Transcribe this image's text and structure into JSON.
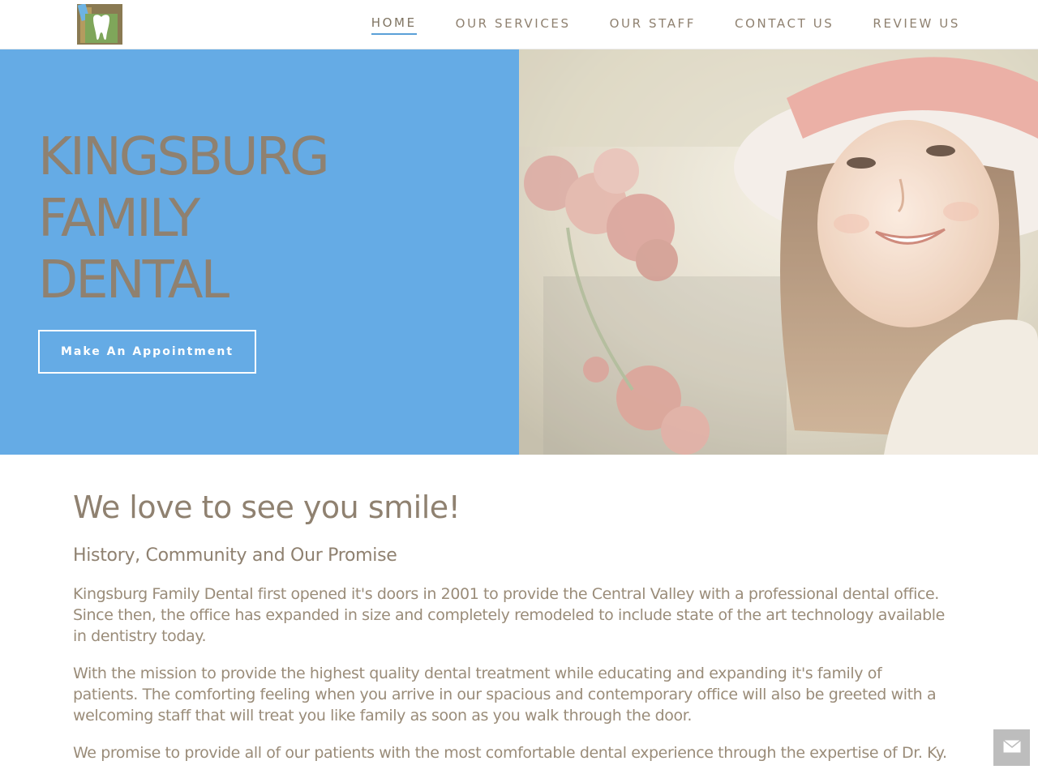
{
  "header": {
    "logo_icon": "tooth-logo-icon",
    "nav": [
      {
        "label": "HOME",
        "active": true
      },
      {
        "label": "OUR SERVICES",
        "active": false
      },
      {
        "label": "OUR STAFF",
        "active": false
      },
      {
        "label": "CONTACT US",
        "active": false
      },
      {
        "label": "REVIEW US",
        "active": false
      }
    ]
  },
  "hero": {
    "title_lines": [
      "KINGSBURG",
      "FAMILY",
      "DENTAL"
    ],
    "button_label": "Make An Appointment",
    "image_subject": "smiling-girl-photo",
    "background_color": "#65abe5"
  },
  "content": {
    "heading": "We love to see you smile!",
    "subheading": "History, Community and Our Promise",
    "paragraphs": [
      "Kingsburg Family Dental first opened it's doors in 2001 to provide the Central Valley with a professional dental office. Since then, the office has expanded in size and completely remodeled to include state of the art technology available in dentistry today.",
      "With the mission to provide the highest quality dental treatment while educating and expanding it's family of patients. The comforting feeling when you arrive in our spacious and contemporary office will also be greeted with a welcoming staff that will treat you like family as soon as you walk through the door.",
      "We promise to provide all of our patients with the most comfortable dental experience through the expertise of Dr. Ky."
    ]
  },
  "widget": {
    "icon": "envelope-icon"
  },
  "colors": {
    "accent_blue": "#65abe5",
    "text_taupe": "#8f8170",
    "widget_gray": "#bdbdbd"
  }
}
